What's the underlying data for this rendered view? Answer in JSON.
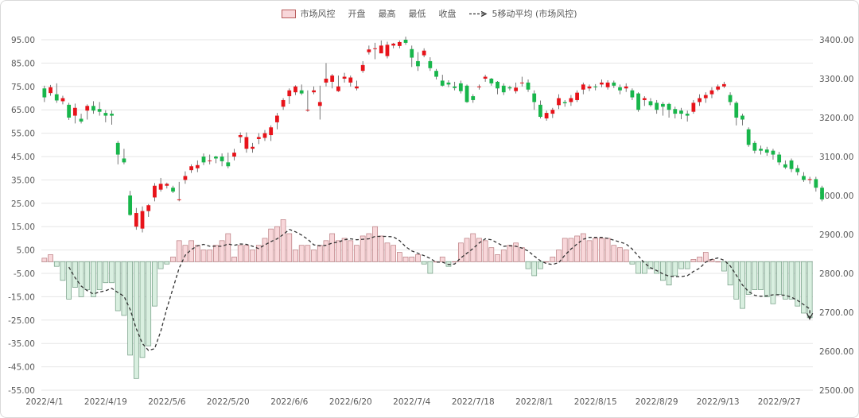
{
  "legend": {
    "item1": "市场风控",
    "item2": "开盘",
    "item3": "最高",
    "item4": "最低",
    "item5": "收盘",
    "item6": "5移动平均 (市场风控)"
  },
  "colors": {
    "up": "#e8131a",
    "down": "#18b64b",
    "bar_pos_fill": "#f8d7da",
    "bar_pos_stroke": "#b97a7e",
    "bar_neg_fill": "#d9efe0",
    "bar_neg_stroke": "#6f9a80",
    "grid": "#e6e6e6",
    "axis_text": "#595959",
    "ma_line": "#333333"
  },
  "chart_data": {
    "type": "bar",
    "left_axis": {
      "min": -55,
      "max": 95,
      "ticks": [
        "95.00",
        "85.00",
        "75.00",
        "65.00",
        "55.00",
        "45.00",
        "35.00",
        "25.00",
        "15.00",
        "5.00",
        "-5.00",
        "-15.00",
        "-25.00",
        "-35.00",
        "-45.00",
        "-55.00"
      ]
    },
    "right_axis": {
      "min": 2500,
      "max": 3400,
      "ticks": [
        "3400.00",
        "3300.00",
        "3200.00",
        "3100.00",
        "3000.00",
        "2900.00",
        "2800.00",
        "2700.00",
        "2600.00",
        "2500.00"
      ]
    },
    "x_tick_labels": [
      "2022/4/1",
      "2022/4/19",
      "2022/5/6",
      "2022/5/20",
      "2022/6/6",
      "2022/6/20",
      "2022/7/4",
      "2022/7/18",
      "2022/8/1",
      "2022/8/15",
      "2022/8/29",
      "2022/9/13",
      "2022/9/27"
    ],
    "x_tick_index": [
      0,
      10,
      20,
      30,
      40,
      50,
      60,
      70,
      80,
      90,
      100,
      110,
      120
    ],
    "bar_series_name": "市场风控",
    "bar_values": [
      1.5,
      3,
      -2,
      -8,
      -16,
      -11,
      -15,
      -12,
      -15,
      -12,
      -9,
      -9,
      -21,
      -23,
      -40,
      -50,
      -41,
      -36,
      -19,
      -3,
      -1,
      2,
      9,
      7,
      9,
      7,
      5,
      5,
      7,
      9,
      12,
      2,
      7,
      7,
      5,
      7,
      10,
      14,
      15,
      18,
      12,
      5,
      7,
      7,
      5,
      7,
      9,
      12,
      9,
      10,
      9,
      7,
      11,
      12,
      15,
      11,
      8,
      7,
      4,
      2,
      2,
      3,
      -1,
      -5,
      0,
      2,
      -2,
      0,
      8,
      10,
      12,
      10,
      9,
      6,
      3,
      5,
      7,
      8,
      6,
      -3,
      -6,
      -3,
      0,
      2,
      5,
      10,
      10,
      11,
      12,
      9,
      10,
      10,
      10,
      7,
      6,
      5,
      -1,
      -5,
      -5,
      -3,
      -5,
      -8,
      -10,
      -6,
      -3,
      -3,
      1,
      2,
      4,
      1,
      0,
      -4,
      -10,
      -16,
      -20,
      -14,
      -12,
      -12,
      -15,
      -18,
      -14,
      -16,
      -16,
      -19,
      -22,
      -24
    ],
    "ma_series_name": "5移动平均 (市场风控)",
    "ma_values": [
      null,
      null,
      null,
      null,
      -2.3,
      -6.8,
      -10.4,
      -12.4,
      -13.8,
      -13,
      -12.4,
      -11.4,
      -13.2,
      -14.8,
      -20.4,
      -28.6,
      -35,
      -38,
      -37.2,
      -29.8,
      -20,
      -11.4,
      -2.8,
      2.8,
      5.2,
      6.8,
      7.4,
      6.6,
      6.6,
      6.6,
      7.6,
      7,
      7.6,
      7.4,
      6.6,
      5.6,
      7.2,
      8.6,
      9.8,
      11.6,
      13.8,
      12.8,
      11.4,
      9.6,
      7.2,
      6.8,
      7,
      8,
      8.4,
      9.4,
      9.8,
      9.4,
      9.6,
      9.8,
      10.8,
      10.8,
      10.8,
      10.6,
      9,
      6.4,
      4.6,
      3.6,
      2.6,
      1.4,
      -0.2,
      -0.2,
      -1.2,
      -1,
      1.6,
      3.6,
      5.6,
      8,
      9.8,
      9.4,
      8,
      6.6,
      6.8,
      6.6,
      5.8,
      4.6,
      2.4,
      0.4,
      -0.8,
      -1.2,
      -0.4,
      2.8,
      5.4,
      7.6,
      9.6,
      10.4,
      10.4,
      10.4,
      10,
      9.2,
      8.4,
      7.6,
      5.4,
      2.4,
      -0.6,
      -2.6,
      -3.8,
      -5.2,
      -6.2,
      -6.4,
      -6.4,
      -6,
      -4.2,
      -2.8,
      -0.2,
      1,
      1.6,
      0.6,
      -1.8,
      -5.8,
      -10,
      -12.8,
      -14.4,
      -14.8,
      -14.6,
      -14.2,
      -14.2,
      -14.4,
      -15.2,
      -16.6,
      -18.4,
      -20.2
    ],
    "ma_arrow_end": -24.5,
    "candles": [
      [
        3275,
        3252,
        3282,
        3240
      ],
      [
        3263,
        3278,
        3284,
        3256
      ],
      [
        3260,
        3244,
        3288,
        3238
      ],
      [
        3242,
        3250,
        3256,
        3234
      ],
      [
        3233,
        3200,
        3238,
        3194
      ],
      [
        3205,
        3225,
        3236,
        3185
      ],
      [
        3197,
        3190,
        3210,
        3185
      ],
      [
        3218,
        3230,
        3234,
        3195
      ],
      [
        3230,
        3218,
        3242,
        3210
      ],
      [
        3222,
        3215,
        3240,
        3205
      ],
      [
        3212,
        3205,
        3219,
        3188
      ],
      [
        3210,
        3205,
        3218,
        3182
      ],
      [
        3135,
        3105,
        3140,
        3080
      ],
      [
        3095,
        3085,
        3120,
        3080
      ],
      [
        3000,
        2950,
        3012,
        2948
      ],
      [
        2920,
        2955,
        2968,
        2912
      ],
      [
        2915,
        2960,
        2972,
        2905
      ],
      [
        2960,
        2975,
        2978,
        2945
      ],
      [
        2995,
        3025,
        3032,
        2985
      ],
      [
        3015,
        3030,
        3045,
        3010
      ],
      [
        3025,
        3030,
        3033,
        3018
      ],
      [
        3020,
        3010,
        3025,
        3006
      ],
      [
        2990,
        2990,
        3035,
        2985
      ],
      [
        3040,
        3050,
        3062,
        3030
      ],
      [
        3065,
        3075,
        3080,
        3058
      ],
      [
        3070,
        3078,
        3090,
        3060
      ],
      [
        3100,
        3085,
        3108,
        3078
      ],
      [
        3090,
        3090,
        3105,
        3080
      ],
      [
        3100,
        3095,
        3102,
        3083
      ],
      [
        3100,
        3088,
        3108,
        3075
      ],
      [
        3085,
        3075,
        3110,
        3070
      ],
      [
        3100,
        3110,
        3120,
        3090
      ],
      [
        3150,
        3155,
        3162,
        3135
      ],
      [
        3120,
        3150,
        3162,
        3110
      ],
      [
        3120,
        3125,
        3135,
        3110
      ],
      [
        3145,
        3150,
        3160,
        3132
      ],
      [
        3148,
        3160,
        3168,
        3140
      ],
      [
        3155,
        3175,
        3180,
        3140
      ],
      [
        3188,
        3205,
        3212,
        3170
      ],
      [
        3228,
        3245,
        3250,
        3220
      ],
      [
        3255,
        3270,
        3275,
        3235
      ],
      [
        3265,
        3280,
        3283,
        3258
      ],
      [
        3270,
        3262,
        3285,
        3258
      ],
      [
        3220,
        3220,
        3270,
        3215
      ],
      [
        3265,
        3270,
        3280,
        3260
      ],
      [
        3230,
        3240,
        3282,
        3195
      ],
      [
        3290,
        3300,
        3340,
        3280
      ],
      [
        3292,
        3308,
        3312,
        3275
      ],
      [
        3268,
        3280,
        3308,
        3266
      ],
      [
        3300,
        3305,
        3315,
        3290
      ],
      [
        3290,
        3303,
        3308,
        3280
      ],
      [
        3275,
        3280,
        3295,
        3270
      ],
      [
        3320,
        3335,
        3345,
        3315
      ],
      [
        3368,
        3375,
        3385,
        3362
      ],
      [
        3376,
        3378,
        3392,
        3350
      ],
      [
        3365,
        3385,
        3398,
        3370
      ],
      [
        3358,
        3387,
        3395,
        3352
      ],
      [
        3385,
        3390,
        3392,
        3378
      ],
      [
        3384,
        3394,
        3398,
        3378
      ],
      [
        3400,
        3392,
        3408,
        3387
      ],
      [
        3376,
        3354,
        3385,
        3330
      ],
      [
        3345,
        3332,
        3368,
        3320
      ],
      [
        3360,
        3372,
        3378,
        3355
      ],
      [
        3345,
        3327,
        3355,
        3320
      ],
      [
        3320,
        3305,
        3325,
        3298
      ],
      [
        3295,
        3282,
        3310,
        3280
      ],
      [
        3290,
        3285,
        3296,
        3278
      ],
      [
        3280,
        3276,
        3292,
        3270
      ],
      [
        3288,
        3268,
        3295,
        3262
      ],
      [
        3282,
        3240,
        3285,
        3238
      ],
      [
        3255,
        3245,
        3260,
        3238
      ],
      [
        3278,
        3280,
        3285,
        3272
      ],
      [
        3300,
        3305,
        3310,
        3292
      ],
      [
        3300,
        3288,
        3302,
        3282
      ],
      [
        3292,
        3275,
        3294,
        3260
      ],
      [
        3282,
        3265,
        3288,
        3258
      ],
      [
        3278,
        3275,
        3282,
        3270
      ],
      [
        3268,
        3277,
        3290,
        3262
      ],
      [
        3288,
        3290,
        3305,
        3280
      ],
      [
        3290,
        3272,
        3298,
        3266
      ],
      [
        3262,
        3240,
        3270,
        3220
      ],
      [
        3233,
        3202,
        3244,
        3198
      ],
      [
        3198,
        3212,
        3218,
        3192
      ],
      [
        3210,
        3220,
        3225,
        3199
      ],
      [
        3232,
        3250,
        3260,
        3222
      ],
      [
        3240,
        3237,
        3245,
        3228
      ],
      [
        3240,
        3250,
        3258,
        3230
      ],
      [
        3245,
        3264,
        3270,
        3240
      ],
      [
        3272,
        3285,
        3290,
        3260
      ],
      [
        3275,
        3280,
        3285,
        3268
      ],
      [
        3280,
        3278,
        3286,
        3270
      ],
      [
        3285,
        3290,
        3298,
        3278
      ],
      [
        3278,
        3290,
        3296,
        3272
      ],
      [
        3290,
        3282,
        3295,
        3276
      ],
      [
        3278,
        3270,
        3285,
        3260
      ],
      [
        3275,
        3280,
        3288,
        3266
      ],
      [
        3270,
        3252,
        3275,
        3245
      ],
      [
        3262,
        3220,
        3265,
        3215
      ],
      [
        3245,
        3250,
        3255,
        3230
      ],
      [
        3242,
        3232,
        3250,
        3228
      ],
      [
        3238,
        3220,
        3245,
        3210
      ],
      [
        3235,
        3228,
        3240,
        3205
      ],
      [
        3235,
        3220,
        3238,
        3200
      ],
      [
        3222,
        3210,
        3228,
        3198
      ],
      [
        3218,
        3210,
        3225,
        3196
      ],
      [
        3210,
        3205,
        3218,
        3190
      ],
      [
        3215,
        3238,
        3245,
        3210
      ],
      [
        3240,
        3250,
        3260,
        3230
      ],
      [
        3250,
        3258,
        3265,
        3238
      ],
      [
        3260,
        3270,
        3278,
        3250
      ],
      [
        3272,
        3280,
        3285,
        3268
      ],
      [
        3280,
        3286,
        3292,
        3276
      ],
      [
        3258,
        3240,
        3265,
        3232
      ],
      [
        3238,
        3200,
        3242,
        3180
      ],
      [
        3205,
        3195,
        3210,
        3180
      ],
      [
        3170,
        3130,
        3175,
        3125
      ],
      [
        3135,
        3115,
        3140,
        3108
      ],
      [
        3120,
        3115,
        3128,
        3105
      ],
      [
        3118,
        3110,
        3125,
        3102
      ],
      [
        3115,
        3105,
        3120,
        3092
      ],
      [
        3105,
        3085,
        3112,
        3078
      ],
      [
        3080,
        3072,
        3090,
        3068
      ],
      [
        3090,
        3068,
        3095,
        3060
      ],
      [
        3070,
        3060,
        3078,
        3052
      ],
      [
        3050,
        3040,
        3060,
        3035
      ],
      [
        3040,
        3042,
        3048,
        3030
      ],
      [
        3042,
        3020,
        3048,
        3010
      ],
      [
        3020,
        2990,
        3025,
        2985
      ]
    ]
  }
}
